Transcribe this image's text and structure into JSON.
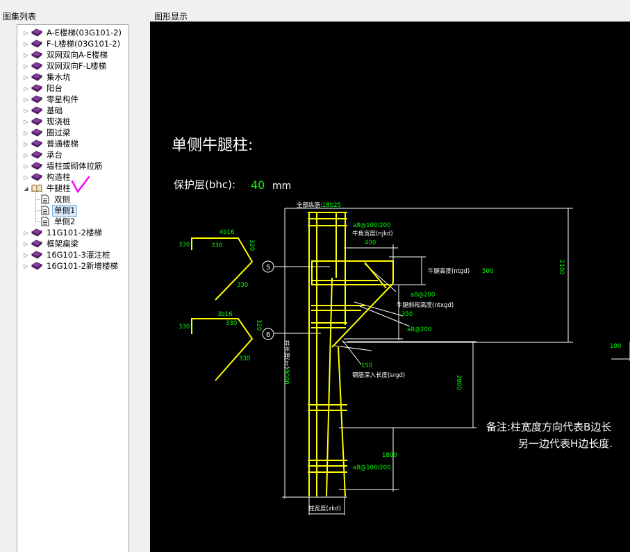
{
  "left_panel": {
    "title": "图集列表",
    "tree": [
      {
        "label": "A-E楼梯(03G101-2)",
        "icon": "book-icon",
        "expander": "collapsed"
      },
      {
        "label": "F-L楼梯(03G101-2)",
        "icon": "book-icon",
        "expander": "collapsed"
      },
      {
        "label": "双网双向A-E楼梯",
        "icon": "book-icon",
        "expander": "collapsed"
      },
      {
        "label": "双网双向F-L楼梯",
        "icon": "book-icon",
        "expander": "collapsed"
      },
      {
        "label": "集水坑",
        "icon": "book-icon",
        "expander": "collapsed"
      },
      {
        "label": "阳台",
        "icon": "book-icon",
        "expander": "collapsed"
      },
      {
        "label": "零星构件",
        "icon": "book-icon",
        "expander": "collapsed"
      },
      {
        "label": "基础",
        "icon": "book-icon",
        "expander": "collapsed"
      },
      {
        "label": "现浇桩",
        "icon": "book-icon",
        "expander": "collapsed"
      },
      {
        "label": "圈过梁",
        "icon": "book-icon",
        "expander": "collapsed"
      },
      {
        "label": "普通楼梯",
        "icon": "book-icon",
        "expander": "collapsed"
      },
      {
        "label": "承台",
        "icon": "book-icon",
        "expander": "collapsed"
      },
      {
        "label": "墙柱或砌体拉筋",
        "icon": "book-icon",
        "expander": "collapsed"
      },
      {
        "label": "构造柱",
        "icon": "book-icon",
        "expander": "collapsed"
      },
      {
        "label": "牛腿柱",
        "icon": "open-book-icon",
        "expander": "expanded"
      },
      {
        "label": "双侧",
        "icon": "document-icon",
        "child": true
      },
      {
        "label": "单侧1",
        "icon": "document-icon",
        "child": true,
        "selected": true
      },
      {
        "label": "单侧2",
        "icon": "document-icon",
        "child": true
      },
      {
        "label": "11G101-2楼梯",
        "icon": "book-icon",
        "expander": "collapsed"
      },
      {
        "label": "框架扁梁",
        "icon": "book-icon",
        "expander": "collapsed"
      },
      {
        "label": "16G101-3灌注桩",
        "icon": "book-icon",
        "expander": "collapsed"
      },
      {
        "label": "16G101-2新增楼梯",
        "icon": "book-icon",
        "expander": "collapsed"
      }
    ]
  },
  "canvas_panel": {
    "title": "图形显示",
    "drawing": {
      "heading": "单侧牛腿柱:",
      "cover_label": "保护层(bhc):",
      "cover_value": "40",
      "cover_unit": "mm",
      "labels": {
        "all_bars": "全部纵筋:",
        "all_bars_value": "18b25",
        "stirrup_top": "a8@100/200",
        "corbel_width": "牛角宽度(njkd)",
        "corbel_width_value": "400",
        "corbel_height": "牛腿高度(ntgd)",
        "corbel_height_value": "500",
        "stirrup_200a": "a8@200",
        "slope_height": "牛腿斜段高度(ntxgd)",
        "slope_height_value": "350",
        "stirrup_200b": "a8@200",
        "anchor_value": "150",
        "anchor_label": "钢筋深入长度(srgd)",
        "column_length": "柱长度(zc)",
        "column_length_value": "9000",
        "dim_2000": "2000",
        "dim_1800": "1800",
        "stirrup_bottom": "a8@100/200",
        "column_width": "柱宽度(zkd)",
        "dim_2100": "2100",
        "dim_100": "100",
        "bar5_name": "4b16",
        "bar6_name": "3b16",
        "bar_seg_330": "330",
        "bar_seg_320": "320",
        "marker_5": "5",
        "marker_6": "6"
      },
      "note_line1": "备注:柱宽度方向代表B边长",
      "note_line2": "另一边代表H边长度.",
      "colors": {
        "yellow": "#ffff00",
        "green": "#00ff00",
        "white": "#ffffff",
        "magenta": "#ff00ff"
      }
    }
  }
}
